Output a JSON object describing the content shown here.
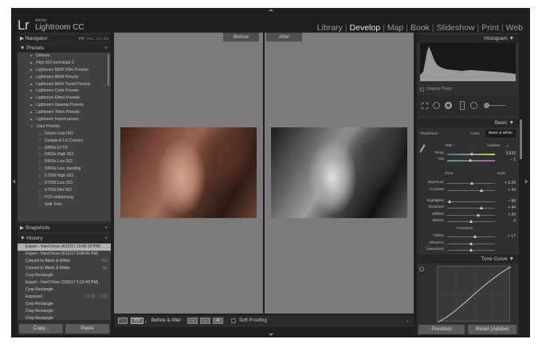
{
  "app": {
    "logo": "Lr",
    "brand_company": "Adobe",
    "brand_name": "Lightroom CC"
  },
  "modules": [
    {
      "label": "Library",
      "active": false
    },
    {
      "label": "Develop",
      "active": true
    },
    {
      "label": "Map",
      "active": false
    },
    {
      "label": "Book",
      "active": false
    },
    {
      "label": "Slideshow",
      "active": false
    },
    {
      "label": "Print",
      "active": false
    },
    {
      "label": "Web",
      "active": false
    }
  ],
  "module_separator": "|",
  "left_panel": {
    "navigator": {
      "title": "Navigator",
      "zoom_options": [
        "FIT",
        "FILL",
        "1:1",
        "3:1"
      ]
    },
    "presets": {
      "title": "Presets",
      "add": "+",
      "items": [
        {
          "label": "Dehaze",
          "level": 1
        },
        {
          "label": "High ISO technique 2",
          "level": 1
        },
        {
          "label": "Lightroom B&W Filter Presets",
          "level": 1
        },
        {
          "label": "Lightroom B&W Presets",
          "level": 1
        },
        {
          "label": "Lightroom B&W Toned Presets",
          "level": 1
        },
        {
          "label": "Lightroom Color Presets",
          "level": 1
        },
        {
          "label": "Lightroom Effect Presets",
          "level": 1
        },
        {
          "label": "Lightroom General Presets",
          "level": 1
        },
        {
          "label": "Lightroom Video Presets",
          "level": 1
        },
        {
          "label": "Lightroom Import preset",
          "level": 1
        },
        {
          "label": "User Presets",
          "level": 1,
          "open": true
        },
        {
          "label": "Ortone Low ISO",
          "level": 2
        },
        {
          "label": "Coolpix A 2.8 Corners",
          "level": 2
        },
        {
          "label": "D800e ETTR",
          "level": 2
        },
        {
          "label": "D800e High ISO",
          "level": 2
        },
        {
          "label": "D800e Low ISO",
          "level": 2
        },
        {
          "label": "D800e Low, banding",
          "level": 2
        },
        {
          "label": "D7000 High ISO",
          "level": 2
        },
        {
          "label": "D7000 Low ISO",
          "level": 2
        },
        {
          "label": "D7000 Mid ISO",
          "level": 2
        },
        {
          "label": "F/16 sharpening",
          "level": 2
        },
        {
          "label": "Split Tone",
          "level": 2
        }
      ]
    },
    "snapshots": {
      "title": "Snapshots",
      "add": "+"
    },
    "history": {
      "title": "History",
      "close": "×",
      "items": [
        {
          "label": "Export - Hard Drive (4/12/17 10:45:10 PM)",
          "before": "",
          "after": "",
          "selected": true
        },
        {
          "label": "Export - Hard Drive (4/12/17 9:08:46 PM)",
          "before": "",
          "after": ""
        },
        {
          "label": "Convert to Black & White",
          "before": "",
          "after": "Yes"
        },
        {
          "label": "Convert to Black & White",
          "before": "",
          "after": "No"
        },
        {
          "label": "Crop Rectangle",
          "before": "",
          "after": ""
        },
        {
          "label": "Export - Hard Drive (3/26/17 5:13:49 PM)",
          "before": "",
          "after": ""
        },
        {
          "label": "Crop Rectangle",
          "before": "",
          "after": ""
        },
        {
          "label": "Exposure",
          "before": "+0.05",
          "after": "0.20"
        },
        {
          "label": "Crop Rectangle",
          "before": "",
          "after": ""
        },
        {
          "label": "Crop Rectangle",
          "before": "",
          "after": ""
        },
        {
          "label": "Crop Rectangle",
          "before": "",
          "after": ""
        }
      ]
    },
    "copy_button": "Copy...",
    "paste_button": "Paste"
  },
  "center": {
    "before_label": "Before",
    "after_label": "After",
    "toolbar": {
      "before_after_label": "Before & After :",
      "soft_proofing_label": "Soft Proofing"
    }
  },
  "right_panel": {
    "histogram": {
      "title": "Histogram",
      "iso": "ISO 100",
      "focal": "14 mm",
      "aperture": "f / 16",
      "shutter": "⅙ sec",
      "original_photo_label": "Original Photo"
    },
    "basic": {
      "title": "Basic",
      "treatment_label": "Treatment :",
      "treatment_color": "Color",
      "treatment_bw": "Black & White",
      "wb_label": "WB :",
      "wb_value": "Custom",
      "temp_label": "Temp",
      "temp_value": "3,933",
      "temp_pos": 0.52,
      "tint_label": "Tint",
      "tint_value": "– 2",
      "tint_pos": 0.49,
      "tone_label": "Tone",
      "auto_label": "Auto",
      "exposure_label": "Exposure",
      "exposure_value": "+ 0.20",
      "exposure_pos": 0.52,
      "contrast_label": "Contrast",
      "contrast_value": "+ 43",
      "contrast_pos": 0.71,
      "highlights_label": "Highlights",
      "highlights_value": "– 90",
      "highlights_pos": 0.05,
      "shadows_label": "Shadows",
      "shadows_value": "+ 44",
      "shadows_pos": 0.72,
      "whites_label": "Whites",
      "whites_value": "+ 30",
      "whites_pos": 0.65,
      "blacks_label": "Blacks",
      "blacks_value": "0",
      "blacks_pos": 0.5,
      "presence_label": "Presence",
      "clarity_label": "Clarity",
      "clarity_value": "+ 17",
      "clarity_pos": 0.58,
      "vibrance_label": "Vibrance",
      "vibrance_pos": 0.5,
      "saturation_label": "Saturation",
      "saturation_pos": 0.5
    },
    "tone_curve": {
      "title": "Tone Curve"
    },
    "previous_button": "Previous",
    "reset_button": "Reset (Adobe)"
  }
}
